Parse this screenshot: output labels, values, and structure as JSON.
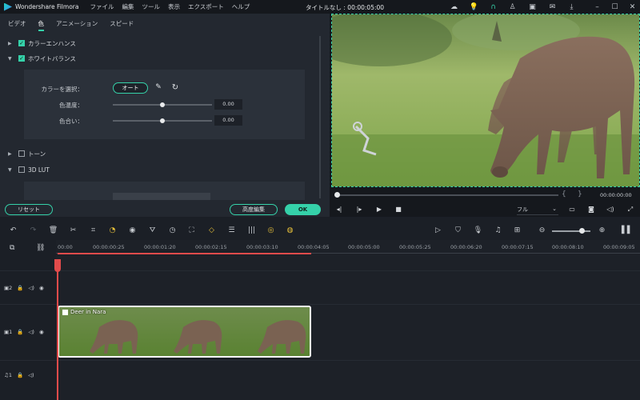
{
  "titlebar": {
    "app_name": "Wondershare Filmora",
    "menu": [
      "ファイル",
      "編集",
      "ツール",
      "表示",
      "エクスポート",
      "ヘルプ"
    ],
    "project_title": "タイトルなし : 00:00:05:00",
    "icons": [
      "cloud-icon",
      "bulb-icon",
      "headset-icon",
      "user-icon",
      "save-icon",
      "mail-icon",
      "download-icon",
      "minimize-icon",
      "maximize-icon",
      "close-icon"
    ]
  },
  "panel": {
    "tabs": [
      "ビデオ",
      "色",
      "アニメーション",
      "スピード"
    ],
    "active_tab": "色",
    "sections": {
      "color_enhance": "カラーエンハンス",
      "white_balance": "ホワイトバランス",
      "tone": "トーン",
      "lut": "3D LUT"
    },
    "white_balance": {
      "color_select_label": "カラーを選択：",
      "auto_button": "オート",
      "temperature_label": "色温度：",
      "temperature_value": "0.00",
      "temperature_level": 0.5,
      "tint_label": "色合い：",
      "tint_value": "0.00",
      "tint_level": 0.5
    },
    "buttons": {
      "reset": "リセット",
      "advanced": "高度編集",
      "ok": "OK"
    }
  },
  "preview": {
    "time": "00:00:00:00",
    "quality": "フル",
    "scrub_position": 0
  },
  "timeline": {
    "ruler_ticks": [
      "00:00",
      "00:00:00:25",
      "00:00:01:20",
      "00:00:02:15",
      "00:00:03:10",
      "00:00:04:05",
      "00:00:05:00",
      "00:00:05:25",
      "00:00:06:20",
      "00:00:07:15",
      "00:00:08:10",
      "00:00:09:05"
    ],
    "tracks": [
      {
        "label": "2",
        "type": "video"
      },
      {
        "label": "1",
        "type": "video"
      },
      {
        "label": "1",
        "type": "audio"
      }
    ],
    "clip_title": "Deer in Nara"
  },
  "colors": {
    "accent": "#35d1a9",
    "playhead": "#e24b4b",
    "highlight": "#e8c13a"
  }
}
